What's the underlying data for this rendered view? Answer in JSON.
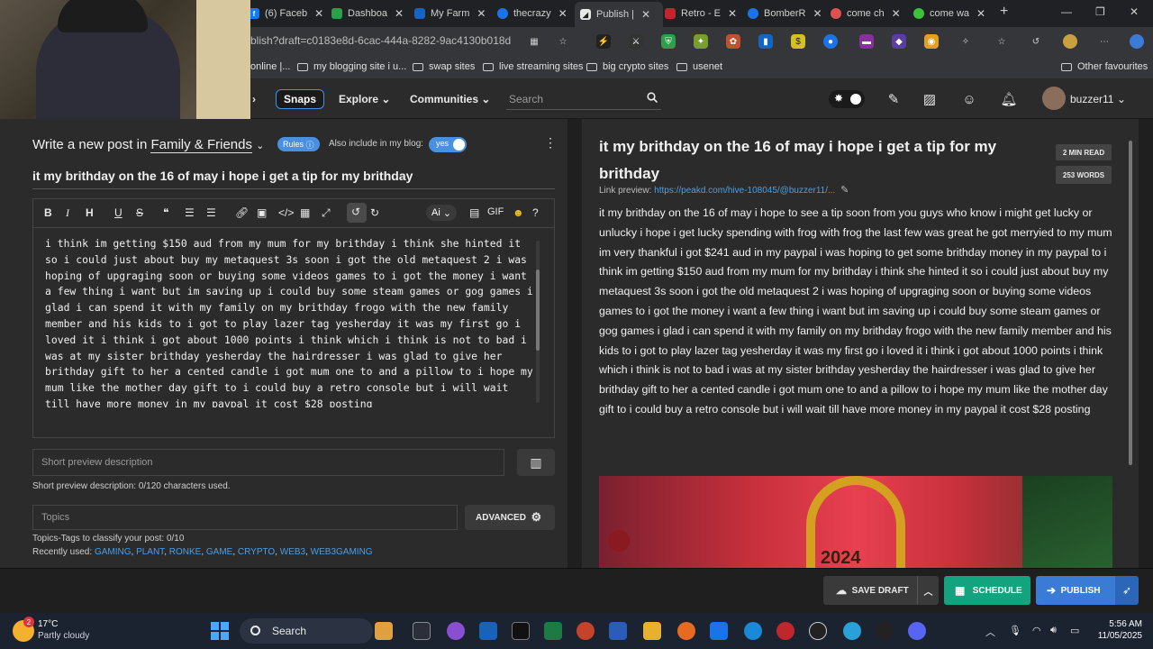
{
  "browser": {
    "tabs": [
      {
        "label": "(6) Faceb",
        "icon_color": "#1877f2",
        "icon_letter": "f"
      },
      {
        "label": "Dashboa",
        "icon_color": "#2e9e4b",
        "icon_letter": "▮"
      },
      {
        "label": "My Farm",
        "icon_color": "#1565c0",
        "icon_letter": "⁂"
      },
      {
        "label": "thecrazy",
        "icon_color": "#1a73e8",
        "icon_letter": "◎"
      },
      {
        "label": "Publish |",
        "icon_color": "#e8e8e8",
        "icon_letter": "◢"
      },
      {
        "label": "Retro - E",
        "icon_color": "#c0272d",
        "icon_letter": "∞"
      },
      {
        "label": "BomberR",
        "icon_color": "#1a73e8",
        "icon_letter": "◎"
      },
      {
        "label": "come ch",
        "icon_color": "#e05050",
        "icon_letter": "✿"
      },
      {
        "label": "come wa",
        "icon_color": "#3cc13b",
        "icon_letter": "▶"
      }
    ],
    "url": "blish?draft=c0183e8d-6cac-444a-8282-9ac4130b018d",
    "bookmarks": [
      "online |...",
      "my blogging site i u...",
      "swap sites",
      "live streaming sites",
      "big crypto sites",
      "usenet"
    ],
    "other_bookmarks": "Other favourites"
  },
  "site_nav": {
    "snaps": "Snaps",
    "explore": "Explore",
    "communities": "Communities",
    "search_placeholder": "Search",
    "username": "buzzer11"
  },
  "editor": {
    "heading_prefix": "Write a new post in",
    "community": "Family & Friends",
    "rules": "Rules",
    "include_blog": "Also include in my blog:",
    "yes": "yes",
    "title": "it my brithday on the 16 of may i hope i get a tip for my brithday",
    "toolbar_ai": "Ai",
    "toolbar_gif": "GIF",
    "body": "i think im getting $150 aud from my mum for my brithday i think she hinted it so i could just about buy my metaquest 3s soon i got the old metaquest 2 i was hoping of upgraging soon or buying some videos games to i got the money i want a few thing i want but im saving up i could buy some steam games or gog games i glad i can spend it with my family on my brithday frogo with the new family member and his kids to i got to play lazer tag yesherday it was my first go i loved it i think i got about 1000 points i think which i think is not to bad i was at my sister brithday yesherday the hairdresser i was glad to give her brithday gift to her a cented candle i got mum one to and a pillow to i hope my mum like the mother day gift to i could buy a retro console but i will wait till have more money in my paypal it cost $28 posting",
    "short_desc_placeholder": "Short preview description",
    "short_desc_info": "Short preview description: 0/120 characters used.",
    "topics_placeholder": "Topics",
    "advanced": "ADVANCED",
    "topics_info": "Topics-Tags to classify your post: 0/10",
    "recent_label": "Recently used:",
    "recent_tags": [
      "GAMING",
      "PLANT",
      "RONKE",
      "GAME",
      "CRYPTO",
      "WEB3",
      "WEB3GAMING"
    ]
  },
  "preview": {
    "title": "it my brithday on the 16 of may i hope i get a tip for my brithday",
    "read_time": "2 MIN READ",
    "word_count": "253 WORDS",
    "link_label": "Link preview:",
    "link": "https://peakd.com/hive-108045/@buzzer11/...",
    "body": "it my brithday on the 16 of may i hope to see a tip soon from you guys who know i might get lucky or unlucky i hope i get lucky spending with frog with frog the last few was great he got merryied to my mum im very thankful i got $241 aud in my paypal i was hoping to get some brithday money in my paypal to i think im getting $150 aud from my mum for my brithday i think she hinted it so i could just about buy my metaquest 3s soon i got the old metaquest 2 i was hoping of upgraging soon or buying some videos games to i got the money i want a few thing i want but im saving up i could buy some steam games or gog games i glad i can spend it with my family on my brithday frogo with the new family member and his kids to i got to play lazer tag yesherday it was my first go i loved it i think i got about 1000 points i think which i think is not to bad i was at my sister brithday yesherday the hairdresser i was glad to give her brithday gift to her a cented candle i got mum one to and a pillow to i hope my mum like the mother day gift to i could buy a retro console but i will wait till have more money in my paypal it cost $28 posting",
    "image_text": "2024"
  },
  "actions": {
    "save_draft": "SAVE DRAFT",
    "schedule": "SCHEDULE",
    "publish": "PUBLISH"
  },
  "taskbar": {
    "weather_badge": "2",
    "temperature": "17°C",
    "condition": "Partly cloudy",
    "search": "Search",
    "time": "5:56 AM",
    "date": "11/05/2025"
  },
  "colors": {
    "accent": "#4a90e2",
    "schedule": "#14a37f",
    "publish": "#3a7bd5",
    "tag": "#4a9fe8"
  }
}
